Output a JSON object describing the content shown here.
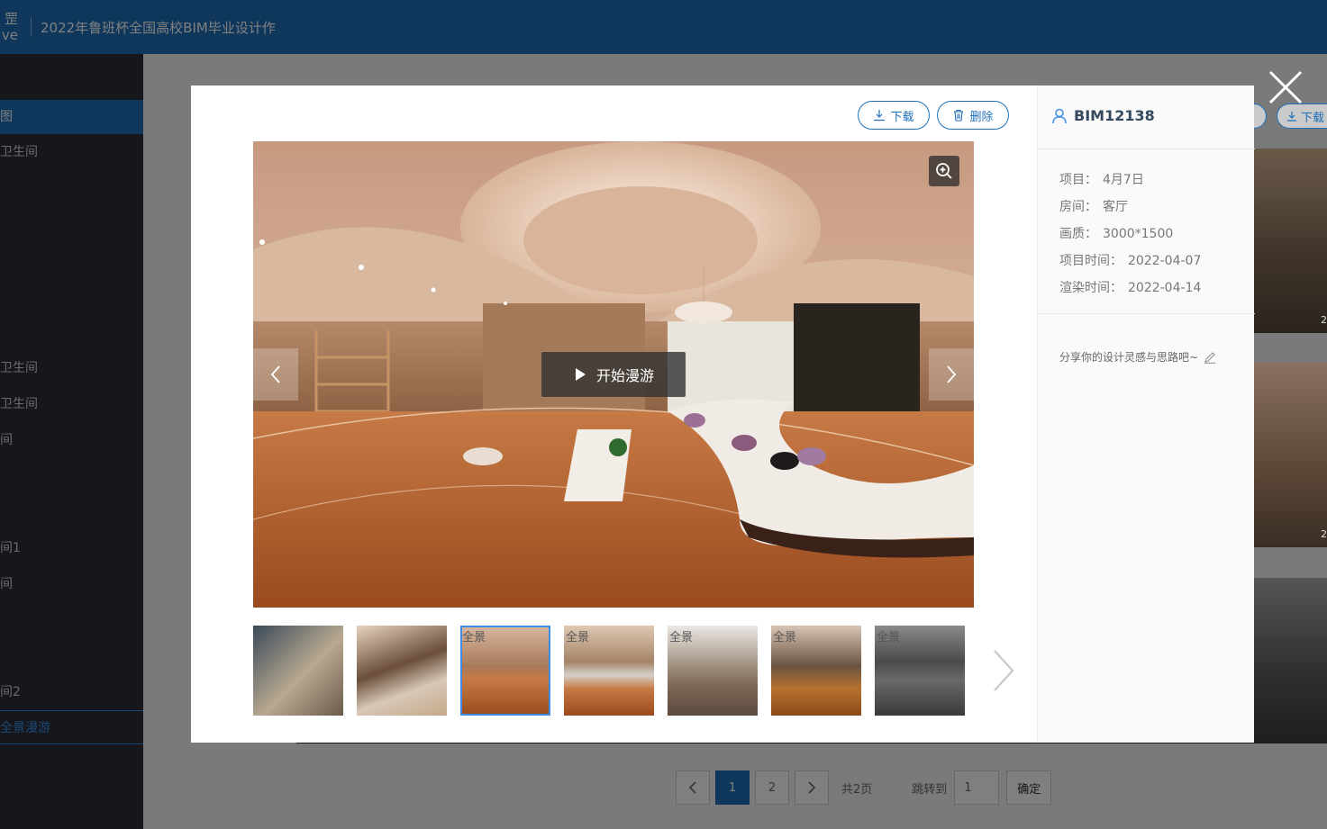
{
  "header": {
    "logo_line1": "罡",
    "logo_line2": "ve",
    "title": "2022年鲁班杯全国高校BIM毕业设计作"
  },
  "sidebar": {
    "items": [
      {
        "label": "图",
        "state": "active"
      },
      {
        "label": "卫生间",
        "state": "normal"
      },
      {
        "label": "卫生间",
        "state": "normal"
      },
      {
        "label": "卫生间",
        "state": "normal"
      },
      {
        "label": "间",
        "state": "normal"
      },
      {
        "label": "间1",
        "state": "normal"
      },
      {
        "label": "间",
        "state": "normal"
      },
      {
        "label": "间2",
        "state": "normal"
      },
      {
        "label": "全景漫游",
        "state": "link"
      }
    ]
  },
  "pagination": {
    "pages": [
      "1",
      "2"
    ],
    "current": "1",
    "total_text": "共2页",
    "jump_label": "跳转到",
    "jump_value": "1",
    "confirm_label": "确定"
  },
  "background_peek": {
    "download_label": "下载",
    "tags": [
      "2",
      "2"
    ]
  },
  "modal": {
    "download_label": "下载",
    "delete_label": "删除",
    "tour_label": "开始漫游",
    "thumbnails": [
      {
        "tag": "",
        "active": false
      },
      {
        "tag": "",
        "active": false
      },
      {
        "tag": "全景",
        "active": true
      },
      {
        "tag": "全景",
        "active": false
      },
      {
        "tag": "全景",
        "active": false
      },
      {
        "tag": "全景",
        "active": false
      },
      {
        "tag": "全景",
        "active": false
      }
    ],
    "user": "BIM12138",
    "info": [
      {
        "key": "项目：",
        "value": "4月7日"
      },
      {
        "key": "房间：",
        "value": "客厅"
      },
      {
        "key": "画质：",
        "value": "3000*1500"
      },
      {
        "key": "项目时间：",
        "value": "2022-04-07"
      },
      {
        "key": "渲染时间：",
        "value": "2022-04-14"
      }
    ],
    "share_placeholder": "分享你的设计灵感与思路吧~"
  },
  "colors": {
    "brand": "#1e6fb8",
    "sidebar_bg": "#2b2f3a",
    "overlay": "rgba(0,0,0,0.5)"
  },
  "icons": [
    "close-icon",
    "download-icon",
    "delete-icon",
    "zoom-in-icon",
    "play-icon",
    "chevron-left-icon",
    "chevron-right-icon",
    "user-icon",
    "edit-icon"
  ]
}
